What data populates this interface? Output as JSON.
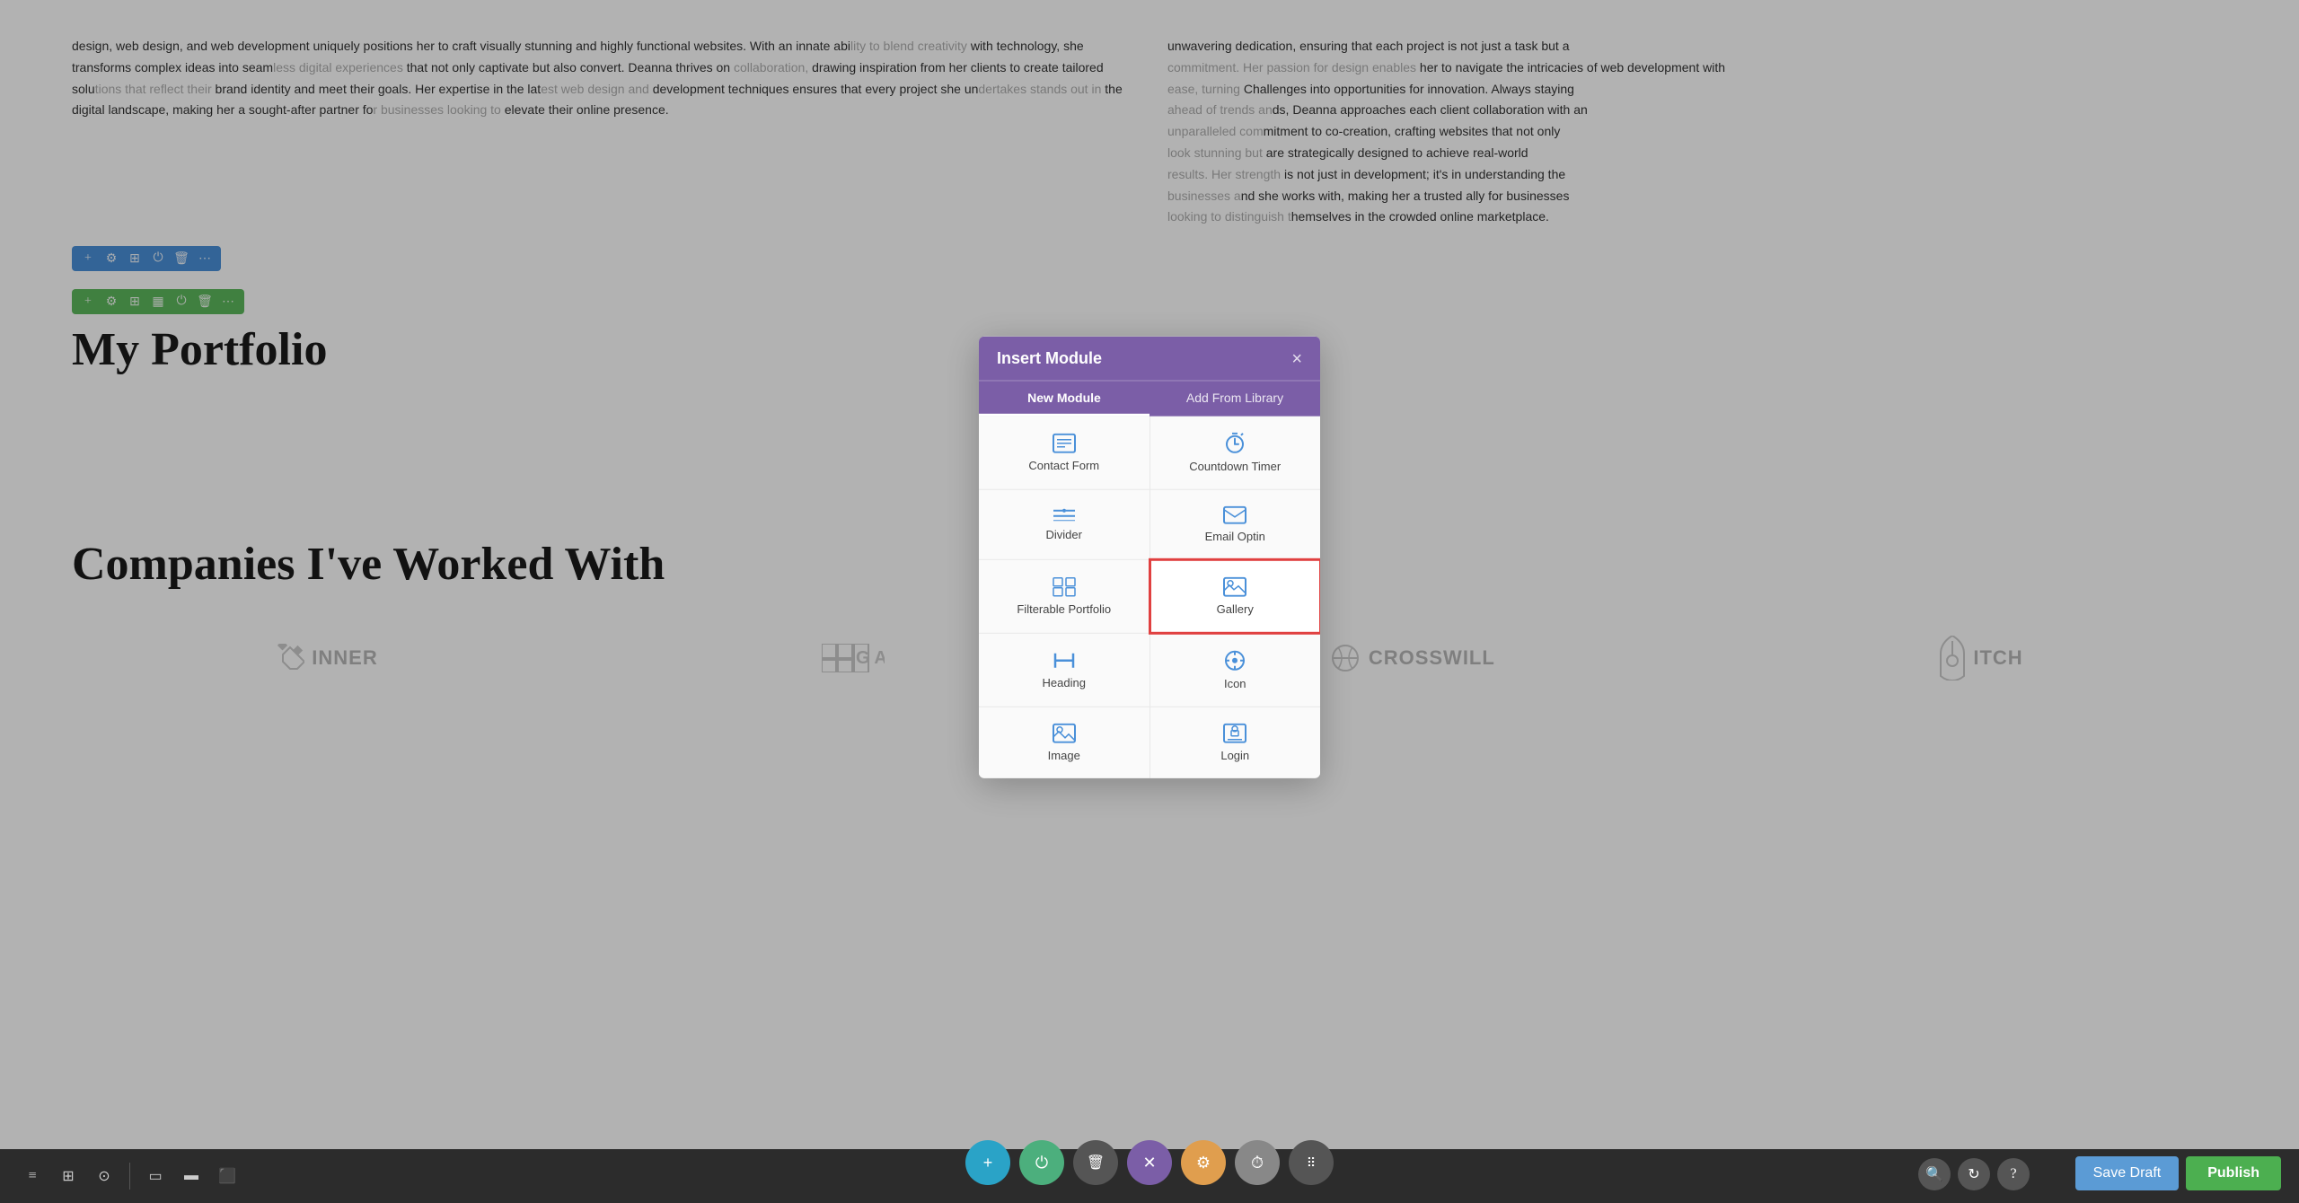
{
  "modal": {
    "title": "Insert Module",
    "close_label": "×",
    "tabs": [
      {
        "id": "new-module",
        "label": "New Module",
        "active": true
      },
      {
        "id": "add-from-library",
        "label": "Add From Library",
        "active": false
      }
    ],
    "modules": [
      {
        "id": "contact-form",
        "label": "Contact Form",
        "icon": "form-icon",
        "selected": false
      },
      {
        "id": "countdown-timer",
        "label": "Countdown Timer",
        "icon": "clock-icon",
        "selected": false
      },
      {
        "id": "divider",
        "label": "Divider",
        "icon": "divider-icon",
        "selected": false
      },
      {
        "id": "email-optin",
        "label": "Email Optin",
        "icon": "email-icon",
        "selected": false
      },
      {
        "id": "filterable-portfolio",
        "label": "Filterable Portfolio",
        "icon": "grid-icon",
        "selected": false
      },
      {
        "id": "gallery",
        "label": "Gallery",
        "icon": "gallery-icon",
        "selected": true
      },
      {
        "id": "heading",
        "label": "Heading",
        "icon": "heading-icon",
        "selected": false
      },
      {
        "id": "icon",
        "label": "Icon",
        "icon": "star-icon",
        "selected": false
      },
      {
        "id": "image",
        "label": "Image",
        "icon": "image-icon",
        "selected": false
      },
      {
        "id": "login",
        "label": "Login",
        "icon": "login-icon",
        "selected": false
      }
    ]
  },
  "page": {
    "left_text": "design, web design, and web development uniquely positions her to craft visually stunning and highly functional websites. With an innate abi... with technology, she transforms complex ideas into seam... that not only captivate but also convert. Deanna thrives on... drawing inspiration from her clients to create tailored solu... brand identity and meet their goals. Her expertise in the lat... development techniques ensures that every project she un... the digital landscape, making her a sought-after partner fo... elevate their online presence.",
    "right_text": "unwavering dedication, ensuring that each project is not just a task but a... her to navigate the intricacies of web development with... Challenges into opportunities for innovation. Always staying... ds, Deanna approaches each client collaboration with an... mitment to co-creation, crafting websites that not only... are strategically designed to achieve real-world... is not just in development; it's in understanding the... nd she works with, making her a trusted ally for businesses... hemselves in the crowded online marketplace.",
    "portfolio_heading": "My Portfolio",
    "companies_heading": "Companies I've Worked With",
    "companies": [
      {
        "name": "INNER",
        "has_logo": true
      },
      {
        "name": "GAED",
        "has_logo": true
      },
      {
        "name": "CROSSWILL",
        "has_logo": true
      },
      {
        "name": "ITCH",
        "has_logo": true
      }
    ]
  },
  "toolbar": {
    "save_draft_label": "Save Draft",
    "publish_label": "Publish"
  },
  "bottom_toolbar": {
    "icons": [
      "≡",
      "⊞",
      "⊙",
      "▭",
      "▬",
      "⬛"
    ]
  },
  "floating_actions": {
    "add_label": "+",
    "power_label": "⏻",
    "delete_label": "🗑",
    "close_label": "✕",
    "settings_label": "⚙",
    "timer_label": "⏱",
    "drag_label": "⠿"
  }
}
